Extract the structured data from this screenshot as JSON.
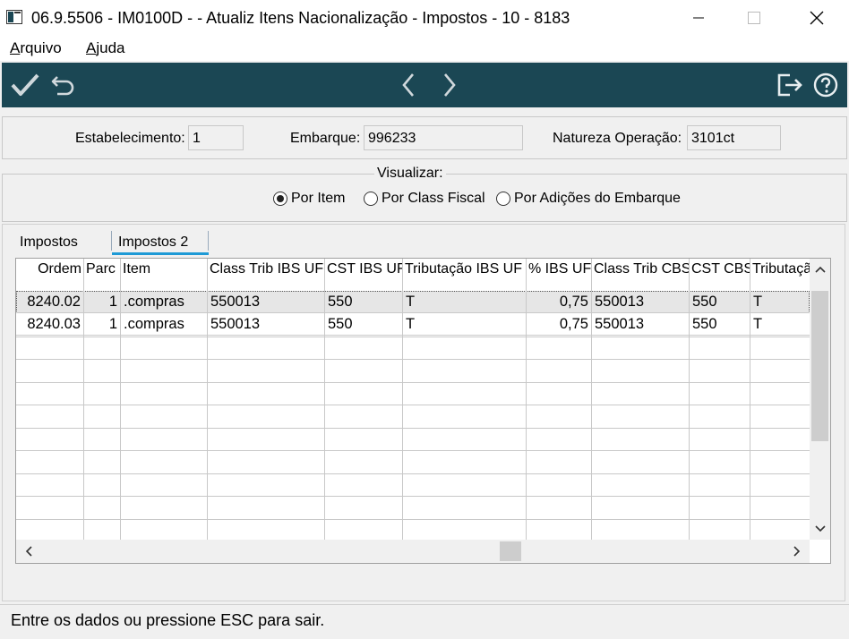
{
  "window": {
    "title": "06.9.5506 - IM0100D -  - Atualiz Itens Nacionalização - Impostos - 10 - 8183"
  },
  "menu": {
    "items": [
      {
        "label": "Arquivo",
        "mnemonic": "A",
        "rest": "rquivo"
      },
      {
        "label": "Ajuda",
        "mnemonic": "A",
        "rest": "juda"
      }
    ]
  },
  "toolbar": {
    "bg_color": "#1b4754",
    "icons": [
      "check-icon",
      "undo-icon",
      "prev-icon",
      "next-icon",
      "exit-icon",
      "help-icon"
    ]
  },
  "header": {
    "estabelecimento_label": "Estabelecimento:",
    "estabelecimento_value": "1",
    "embarque_label": "Embarque:",
    "embarque_value": "996233",
    "natureza_label": "Natureza Operação:",
    "natureza_value": "3101ct"
  },
  "visualizar": {
    "label": "Visualizar:",
    "options": [
      "Por Item",
      "Por Class Fiscal",
      "Por Adições do Embarque"
    ],
    "selected": "Por Item"
  },
  "tabs": {
    "items": [
      "Impostos",
      "Impostos 2"
    ],
    "active": "Impostos 2",
    "accent_color": "#1e9ad6"
  },
  "grid": {
    "columns": [
      "Ordem",
      "Parc",
      "Item",
      "Class Trib IBS UF",
      "CST IBS UF",
      "Tributação IBS UF",
      "% IBS UF",
      "Class Trib CBS",
      "CST CBS",
      "Tributaçã"
    ],
    "rows": [
      [
        "8240.02",
        "1",
        ".compras",
        "550013",
        "550",
        "T",
        "0,75",
        "550013",
        "550",
        "T"
      ],
      [
        "8240.03",
        "1",
        ".compras",
        "550013",
        "550",
        "T",
        "0,75",
        "550013",
        "550",
        "T"
      ]
    ]
  },
  "status": {
    "text": "Entre os dados ou pressione ESC para sair."
  }
}
